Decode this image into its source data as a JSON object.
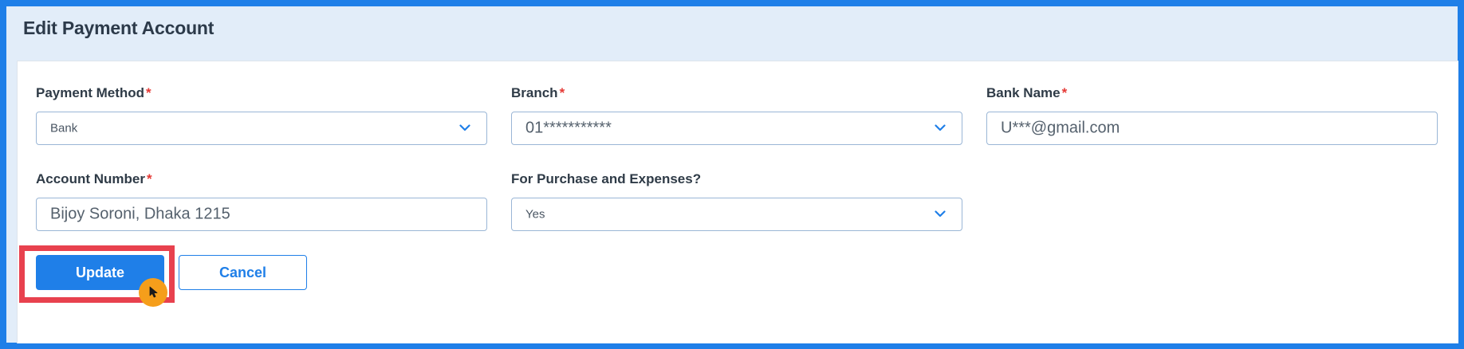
{
  "page": {
    "title": "Edit Payment Account"
  },
  "form": {
    "payment_method": {
      "label": "Payment Method",
      "required_mark": "*",
      "value": "Bank"
    },
    "branch": {
      "label": "Branch",
      "required_mark": "*",
      "value": "01***********"
    },
    "bank_name": {
      "label": "Bank Name",
      "required_mark": "*",
      "value": "U***@gmail.com"
    },
    "account_number": {
      "label": "Account Number",
      "required_mark": "*",
      "value": "Bijoy Soroni, Dhaka 1215"
    },
    "purchase_expenses": {
      "label": "For Purchase and Expenses?",
      "value": "Yes"
    }
  },
  "actions": {
    "update_label": "Update",
    "cancel_label": "Cancel"
  },
  "icons": {
    "dropdown": "chevron-down-icon",
    "cursor": "mouse-pointer-icon"
  },
  "colors": {
    "accent": "#1f7fe8",
    "highlight": "#e8414e",
    "cursor": "#f59e1b",
    "required": "#e53935"
  }
}
